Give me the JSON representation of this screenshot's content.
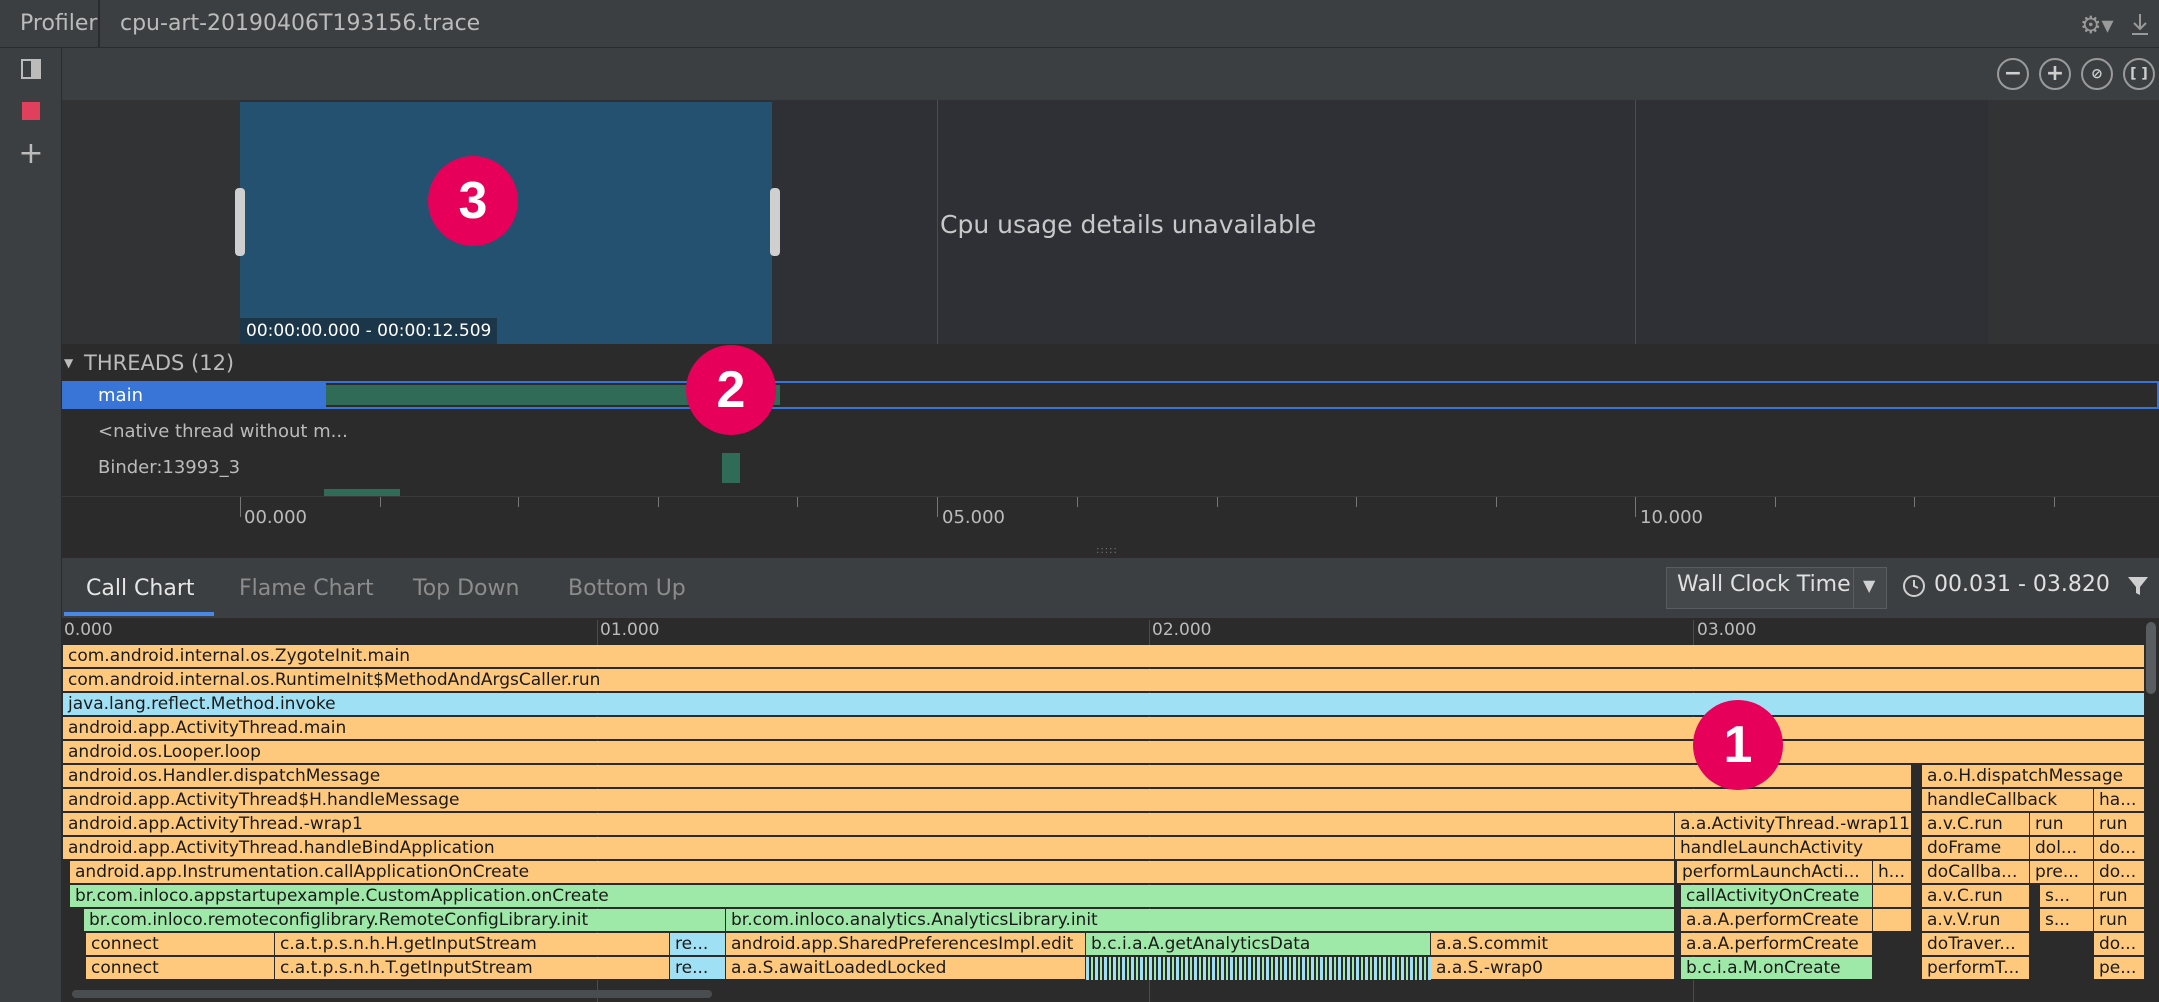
{
  "titlebar": {
    "app_title": "Profiler",
    "trace_tab": "cpu-art-20190406T193156.trace"
  },
  "timeline": {
    "selection_range": "00:00:00.000 - 00:00:12.509",
    "cpu_message": "Cpu usage details unavailable"
  },
  "threads": {
    "header": "THREADS (12)",
    "items": [
      {
        "name": "main"
      },
      {
        "name": "<native thread without m..."
      },
      {
        "name": "Binder:13993_3"
      }
    ]
  },
  "ruler": {
    "labels": [
      "00.000",
      "05.000",
      "10.000"
    ]
  },
  "tabs": [
    {
      "label": "Call Chart",
      "active": true
    },
    {
      "label": "Flame Chart",
      "active": false
    },
    {
      "label": "Top Down",
      "active": false
    },
    {
      "label": "Bottom Up",
      "active": false
    }
  ],
  "clock": {
    "selected": "Wall Clock Time",
    "range": "00.031 - 03.820"
  },
  "call_chart": {
    "axis_labels": [
      "0.000",
      "01.000",
      "02.000",
      "03.000"
    ],
    "rows": [
      [
        "com.android.internal.os.ZygoteInit.main"
      ],
      [
        "com.android.internal.os.RuntimeInit$MethodAndArgsCaller.run"
      ],
      [
        "java.lang.reflect.Method.invoke"
      ],
      [
        "android.app.ActivityThread.main"
      ],
      [
        "android.os.Looper.loop"
      ],
      [
        "android.os.Handler.dispatchMessage",
        "a.o.H.dispatchMessage"
      ],
      [
        "android.app.ActivityThread$H.handleMessage",
        "handleCallback",
        "ha..."
      ],
      [
        "android.app.ActivityThread.-wrap1",
        "a.a.ActivityThread.-wrap11",
        "a.v.C.run",
        "run",
        "run"
      ],
      [
        "android.app.ActivityThread.handleBindApplication",
        "handleLaunchActivity",
        "doFrame",
        "dol...",
        "do..."
      ],
      [
        "android.app.Instrumentation.callApplicationOnCreate",
        "performLaunchActi...",
        "h...",
        "doCallba...",
        "pre...",
        "do..."
      ],
      [
        "br.com.inloco.appstartupexample.CustomApplication.onCreate",
        "callActivityOnCreate",
        "a.v.C.run",
        "s...",
        "run"
      ],
      [
        "br.com.inloco.remoteconfiglibrary.RemoteConfigLibrary.init",
        "br.com.inloco.analytics.AnalyticsLibrary.init",
        "a.a.A.performCreate",
        "a.v.V.run",
        "s...",
        "run"
      ],
      [
        "connect",
        "c.a.t.p.s.n.h.H.getInputStream",
        "re...",
        "android.app.SharedPreferencesImpl.edit",
        "b.c.i.a.A.getAnalyticsData",
        "a.a.S.commit",
        "a.a.A.performCreate",
        "doTraver...",
        "do..."
      ],
      [
        "connect",
        "c.a.t.p.s.n.h.T.getInputStream",
        "re...",
        "a.a.S.awaitLoadedLocked",
        "a.a.S.-wrap0",
        "b.c.i.a.M.onCreate",
        "performT...",
        "pe..."
      ]
    ]
  },
  "badges": [
    "1",
    "2",
    "3"
  ]
}
